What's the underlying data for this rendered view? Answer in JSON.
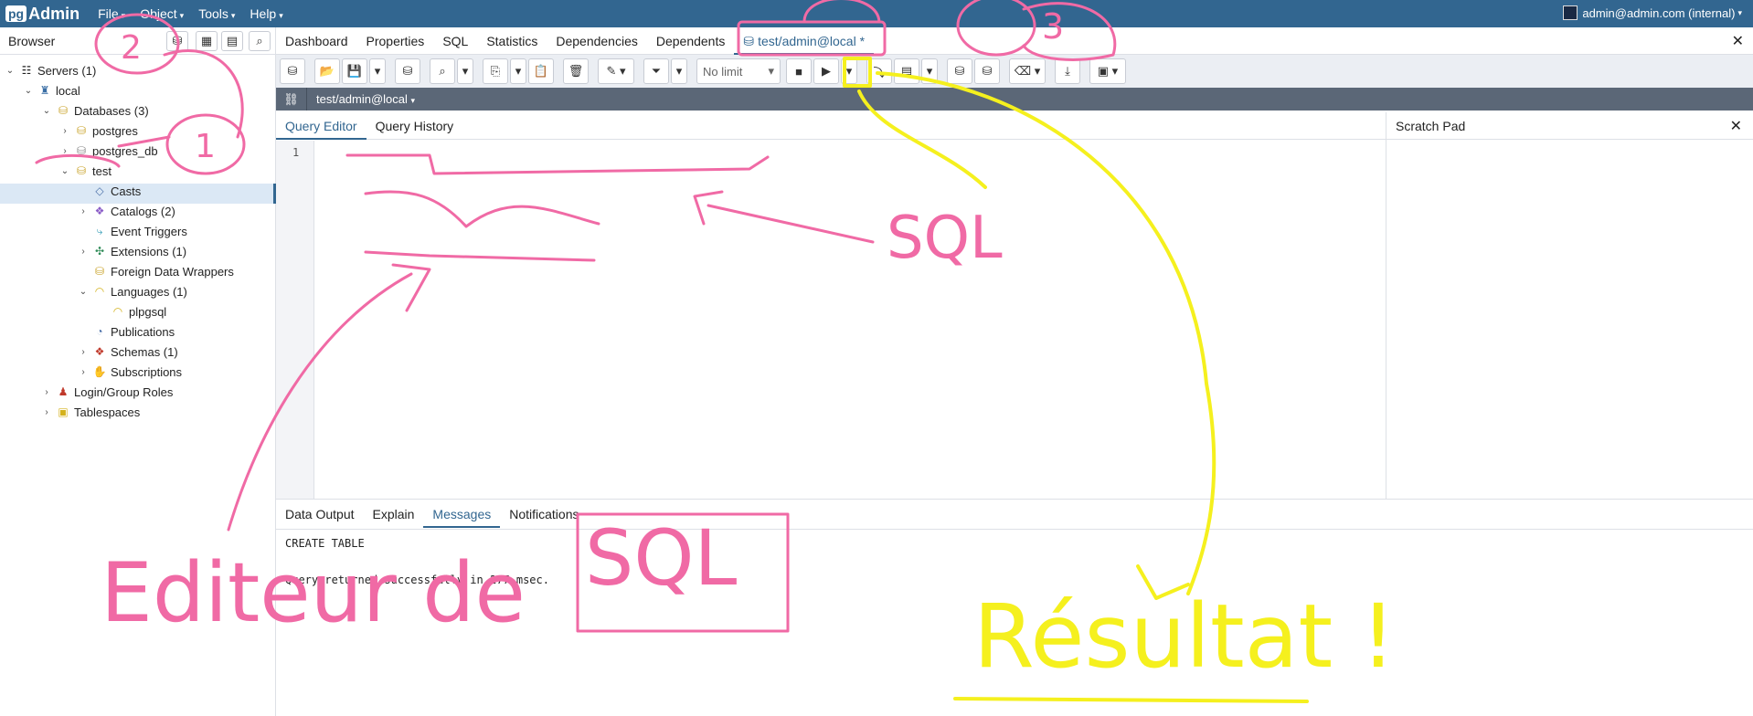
{
  "app": {
    "brand_pg": "pg",
    "brand_name": "Admin"
  },
  "menu": [
    {
      "label": "File"
    },
    {
      "label": "Object"
    },
    {
      "label": "Tools"
    },
    {
      "label": "Help"
    }
  ],
  "user": {
    "label": "admin@admin.com (internal)"
  },
  "browser": {
    "title": "Browser"
  },
  "tree": [
    {
      "label": "Servers (1)",
      "toggle": "v"
    },
    {
      "label": "local",
      "toggle": "v"
    },
    {
      "label": "Databases (3)",
      "toggle": "v"
    },
    {
      "label": "postgres",
      "toggle": ">"
    },
    {
      "label": "postgres_db",
      "toggle": ">"
    },
    {
      "label": "test",
      "toggle": "v"
    },
    {
      "label": "Casts",
      "toggle": ""
    },
    {
      "label": "Catalogs (2)",
      "toggle": ">"
    },
    {
      "label": "Event Triggers",
      "toggle": ""
    },
    {
      "label": "Extensions (1)",
      "toggle": ">"
    },
    {
      "label": "Foreign Data Wrappers",
      "toggle": ""
    },
    {
      "label": "Languages (1)",
      "toggle": "v"
    },
    {
      "label": "plpgsql",
      "toggle": ""
    },
    {
      "label": "Publications",
      "toggle": ""
    },
    {
      "label": "Schemas (1)",
      "toggle": ">"
    },
    {
      "label": "Subscriptions",
      "toggle": ">"
    },
    {
      "label": "Login/Group Roles",
      "toggle": ">"
    },
    {
      "label": "Tablespaces",
      "toggle": ">"
    }
  ],
  "tabs": [
    {
      "label": "Dashboard"
    },
    {
      "label": "Properties"
    },
    {
      "label": "SQL"
    },
    {
      "label": "Statistics"
    },
    {
      "label": "Dependencies"
    },
    {
      "label": "Dependents"
    },
    {
      "label": "test/admin@local *"
    }
  ],
  "toolbar": {
    "limit": "No limit"
  },
  "connection": {
    "label": "test/admin@local"
  },
  "query_tabs": [
    {
      "label": "Query Editor"
    },
    {
      "label": "Query History"
    }
  ],
  "editor": {
    "line_number": "1"
  },
  "scratch": {
    "title": "Scratch Pad"
  },
  "result_tabs": [
    {
      "label": "Data Output"
    },
    {
      "label": "Explain"
    },
    {
      "label": "Messages"
    },
    {
      "label": "Notifications"
    }
  ],
  "messages": {
    "line1": "CREATE TABLE",
    "line2": "Query returned successfully in 277 msec."
  },
  "annotations": {
    "num_2": "2",
    "num_1": "1",
    "num_3": "3",
    "sql_label": "SQL",
    "editor_label": "Editeur de",
    "boxed_sql": "SQL",
    "result_label": "Résultat !",
    "pink": "#f06aa5",
    "yellow": "#f5f01e"
  },
  "colors": {
    "navbar": "#326690",
    "accent": "#326690",
    "connbar": "#5b6777"
  }
}
